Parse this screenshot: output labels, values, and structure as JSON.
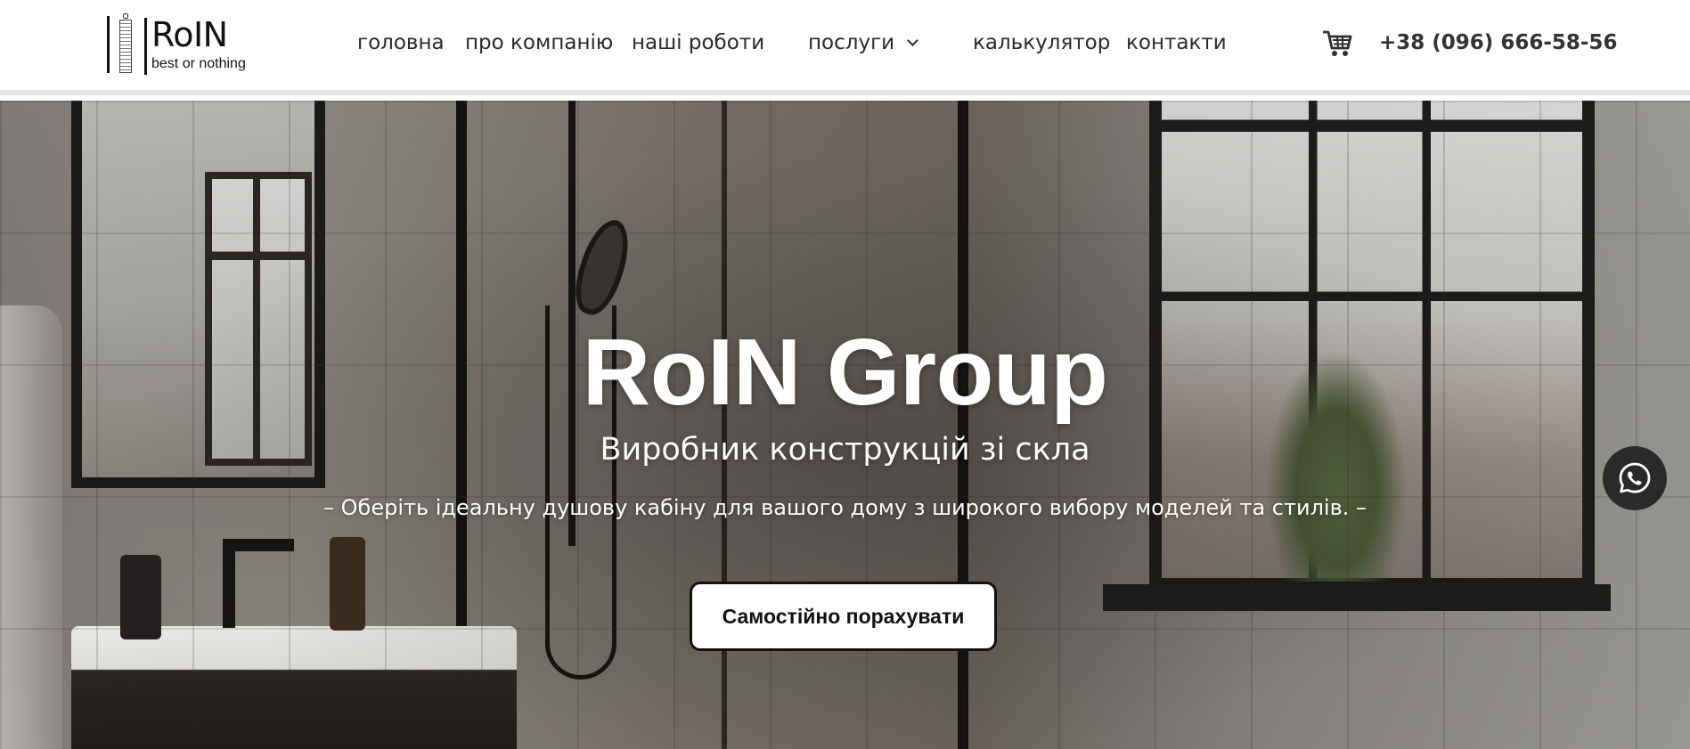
{
  "header": {
    "logo": {
      "name": "RoIN",
      "tagline": "best or nothing"
    },
    "nav": {
      "items": [
        {
          "label": "головна"
        },
        {
          "label": "про компанію"
        },
        {
          "label": "наші роботи"
        },
        {
          "label": "послуги",
          "icon": "chevron-down-icon"
        },
        {
          "label": "калькулятор"
        },
        {
          "label": "контакти"
        }
      ]
    },
    "cart_icon": "cart-icon",
    "phone": "+38 (096) 666-58-56"
  },
  "hero": {
    "title": "RoIN Group",
    "subtitle": "Виробник конструкцій зі скла",
    "description": "– Оберіть ідеальну душову кабіну для вашого дому з широкого вибору моделей та стилів. –",
    "cta_label": "Самостійно порахувати"
  },
  "floating": {
    "whatsapp_icon": "whatsapp-icon"
  },
  "colors": {
    "text_dark": "#2a2a2a",
    "button_bg": "#ffffff",
    "button_border": "#111111",
    "whatsapp_bg": "#2a2a2a"
  }
}
